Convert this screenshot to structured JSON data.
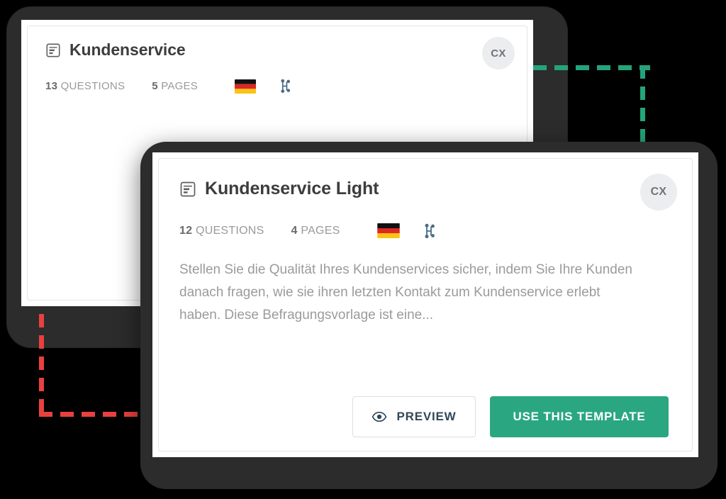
{
  "back_card": {
    "doc_icon": "survey-document-icon",
    "title": "Kundenservice",
    "avatar_initials": "CX",
    "meta": {
      "questions_count": "13",
      "questions_label": "QUESTIONS",
      "pages_count": "5",
      "pages_label": "PAGES",
      "flag": "germany-flag-icon",
      "logic": "branch-logic-icon"
    }
  },
  "front_card": {
    "doc_icon": "survey-document-icon",
    "title": "Kundenservice Light",
    "avatar_initials": "CX",
    "meta": {
      "questions_count": "12",
      "questions_label": "QUESTIONS",
      "pages_count": "4",
      "pages_label": "PAGES",
      "flag": "germany-flag-icon",
      "logic": "branch-logic-icon"
    },
    "description": "Stellen Sie die Qualität Ihres Kundenservices sicher, indem Sie Ihre Kunden danach fragen, wie sie ihren letzten Kontakt zum Kundenservice erlebt haben. Diese Befragungsvorlage ist eine...",
    "buttons": {
      "preview_label": "PREVIEW",
      "preview_icon": "eye-icon",
      "use_template_label": "USE THIS TEMPLATE"
    }
  },
  "annotations": {
    "green_color": "#23a47c",
    "red_color": "#e8413f"
  },
  "colors": {
    "frame": "#2c2c2c",
    "accent_green": "#2aa781",
    "title_text": "#3d3d3d",
    "muted_text": "#9a9a9a",
    "avatar_bg": "#ecedef",
    "preview_text": "#2f4858"
  }
}
